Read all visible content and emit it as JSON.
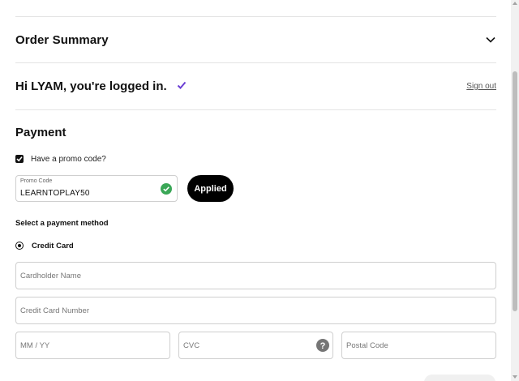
{
  "order_summary": {
    "title": "Order Summary"
  },
  "login": {
    "text": "Hi LYAM, you're logged in.",
    "signout_label": "Sign out"
  },
  "payment": {
    "title": "Payment",
    "promo": {
      "checkbox_label": "Have a promo code?",
      "checked": true,
      "field_label": "Promo Code",
      "value": "LEARNTOPLAY50",
      "applied_button": "Applied"
    },
    "method_title": "Select a payment method",
    "method_option": "Credit Card",
    "fields": {
      "cardholder_placeholder": "Cardholder Name",
      "card_number_placeholder": "Credit Card Number",
      "expiry_placeholder": "MM / YY",
      "cvc_placeholder": "CVC",
      "postal_placeholder": "Postal Code"
    }
  },
  "colors": {
    "accent_purple": "#6b3fd4",
    "success_green": "#3aa757",
    "button_black": "#000000"
  },
  "icons": [
    "chevron-down-icon",
    "checkmark-icon",
    "check-circle-icon",
    "help-circle-icon"
  ]
}
